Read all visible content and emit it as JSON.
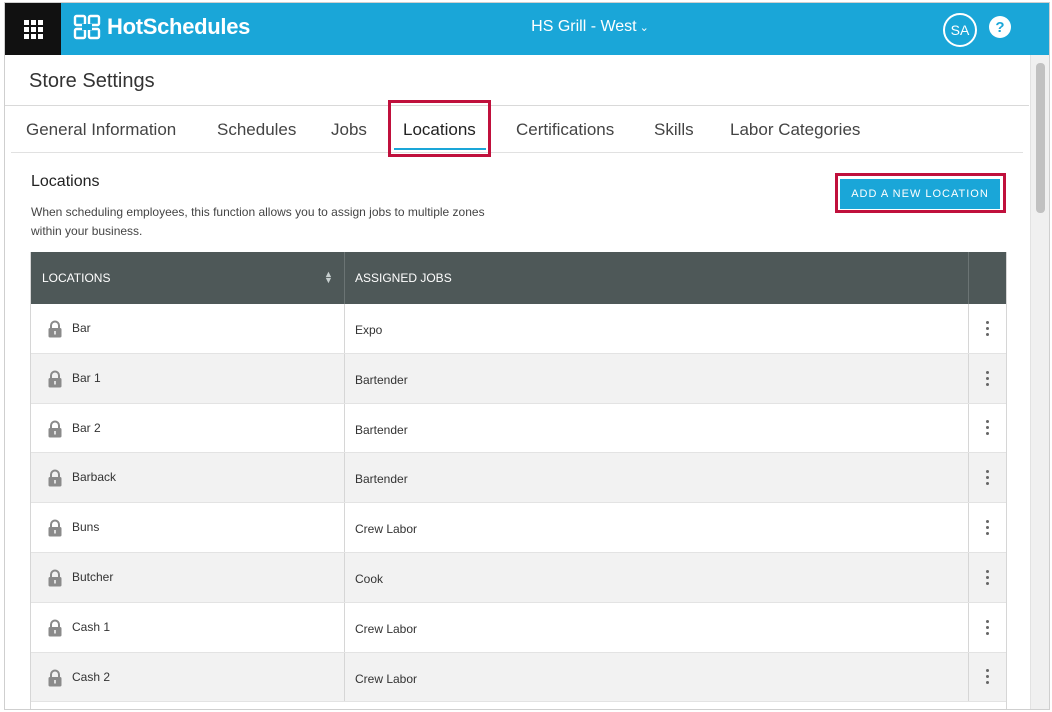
{
  "header": {
    "logo_text": "HotSchedules",
    "store_name": "HS Grill - West",
    "user_initials": "SA",
    "help_label": "?"
  },
  "page": {
    "title": "Store Settings"
  },
  "tabs": [
    {
      "label": "General Information"
    },
    {
      "label": "Schedules"
    },
    {
      "label": "Jobs"
    },
    {
      "label": "Locations",
      "active": true
    },
    {
      "label": "Certifications"
    },
    {
      "label": "Skills"
    },
    {
      "label": "Labor Categories"
    }
  ],
  "section": {
    "title": "Locations",
    "description": "When scheduling employees, this function allows you to assign jobs to multiple zones within your business.",
    "add_button": "ADD A NEW LOCATION"
  },
  "table": {
    "columns": [
      "LOCATIONS",
      "ASSIGNED JOBS"
    ],
    "rows": [
      {
        "location": "Bar",
        "job": "Expo"
      },
      {
        "location": "Bar 1",
        "job": "Bartender"
      },
      {
        "location": "Bar 2",
        "job": "Bartender"
      },
      {
        "location": "Barback",
        "job": "Bartender"
      },
      {
        "location": "Buns",
        "job": "Crew Labor"
      },
      {
        "location": "Butcher",
        "job": "Cook"
      },
      {
        "location": "Cash 1",
        "job": "Crew Labor"
      },
      {
        "location": "Cash 2",
        "job": "Crew Labor"
      }
    ]
  },
  "colors": {
    "brand": "#1aa6d8",
    "header_dark": "#111111",
    "table_header": "#4e5858",
    "highlight": "#c0103c"
  },
  "icons": {
    "apps": "grid-icon",
    "lock": "lock-icon",
    "sort": "sort-icon",
    "row_menu": "more-vertical-icon",
    "help": "help-icon",
    "dropdown": "chevron-down-icon"
  }
}
